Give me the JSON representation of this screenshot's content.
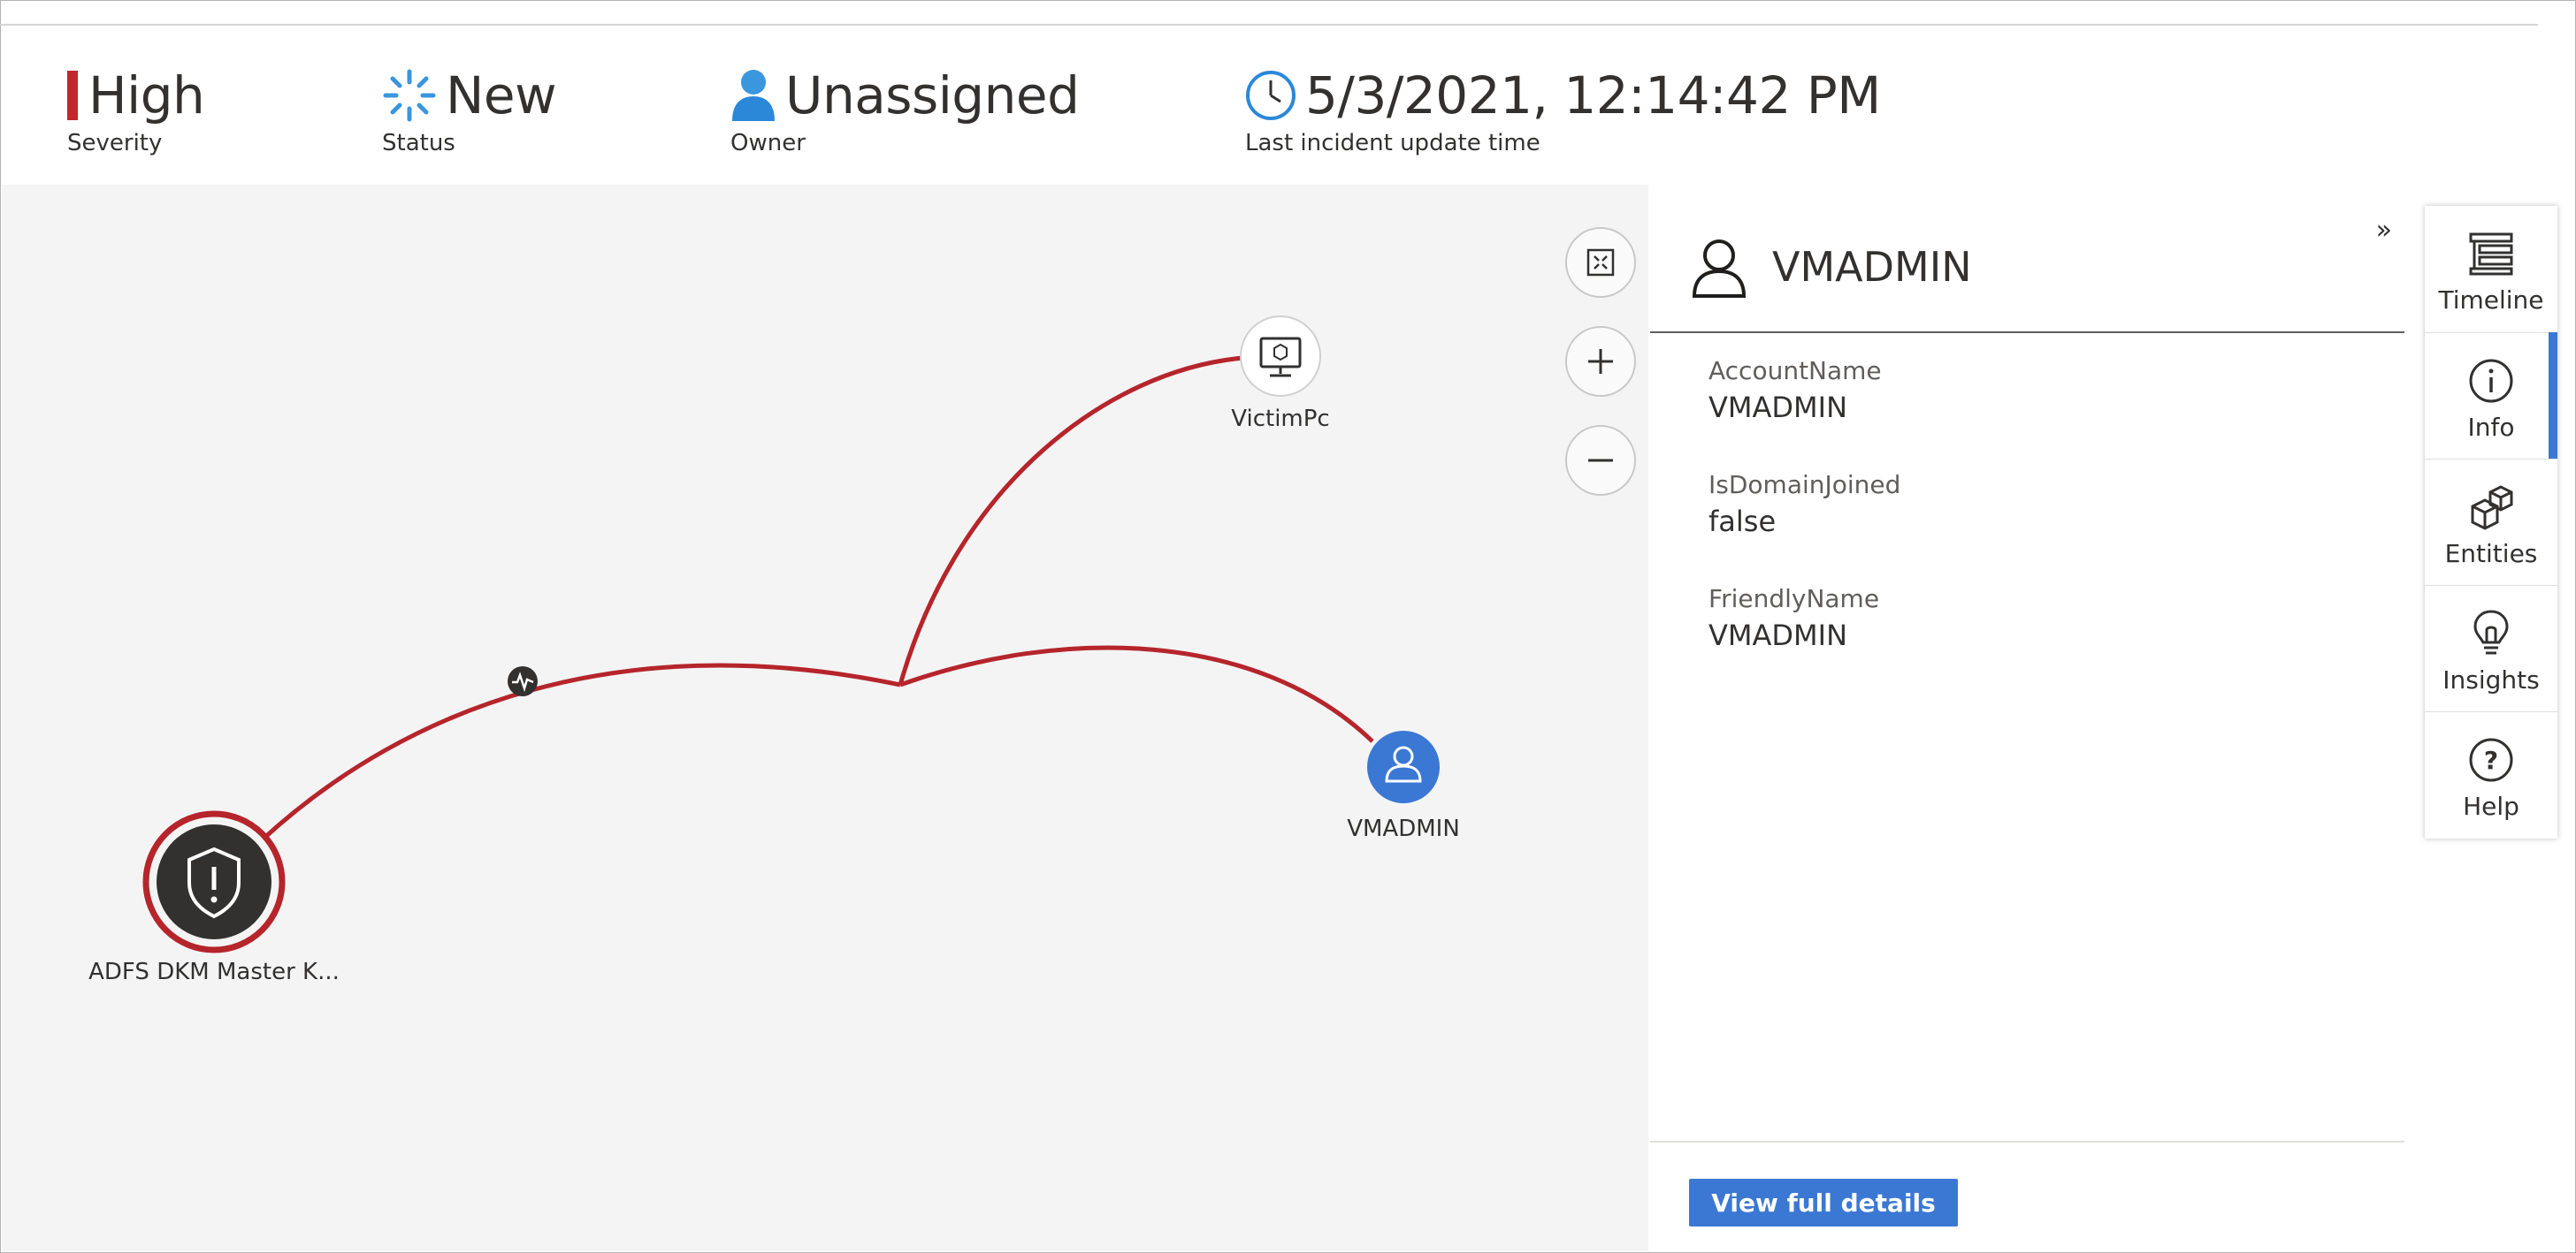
{
  "header": {
    "severity": {
      "value": "High",
      "label": "Severity",
      "color": "#c4262e"
    },
    "status": {
      "value": "New",
      "label": "Status",
      "icon": "spinner-icon",
      "color": "#3a96dd"
    },
    "owner": {
      "value": "Unassigned",
      "label": "Owner",
      "icon": "person-icon"
    },
    "updated": {
      "value": "5/3/2021, 12:14:42 PM",
      "label": "Last incident update time",
      "icon": "clock-icon"
    }
  },
  "graph": {
    "nodes": {
      "alert": {
        "label": "ADFS DKM Master K...",
        "icon": "shield-alert-icon"
      },
      "host": {
        "label": "VictimPc",
        "icon": "computer-icon"
      },
      "account": {
        "label": "VMADMIN",
        "icon": "user-icon"
      },
      "activity": {
        "icon": "pulse-icon"
      }
    },
    "edge_color": "#b5252b",
    "controls": [
      "fit-to-screen-icon",
      "zoom-in-icon",
      "zoom-out-icon"
    ]
  },
  "panel": {
    "title": "VMADMIN",
    "icon": "user-icon",
    "fields": [
      {
        "label": "AccountName",
        "value": "VMADMIN"
      },
      {
        "label": "IsDomainJoined",
        "value": "false"
      },
      {
        "label": "FriendlyName",
        "value": "VMADMIN"
      }
    ],
    "button": "View full details",
    "accent": "#3b78d4"
  },
  "rail": {
    "items": [
      {
        "label": "Timeline",
        "icon": "timeline-icon"
      },
      {
        "label": "Info",
        "icon": "info-icon",
        "active": true
      },
      {
        "label": "Entities",
        "icon": "entities-icon"
      },
      {
        "label": "Insights",
        "icon": "lightbulb-icon"
      },
      {
        "label": "Help",
        "icon": "help-icon"
      }
    ]
  }
}
